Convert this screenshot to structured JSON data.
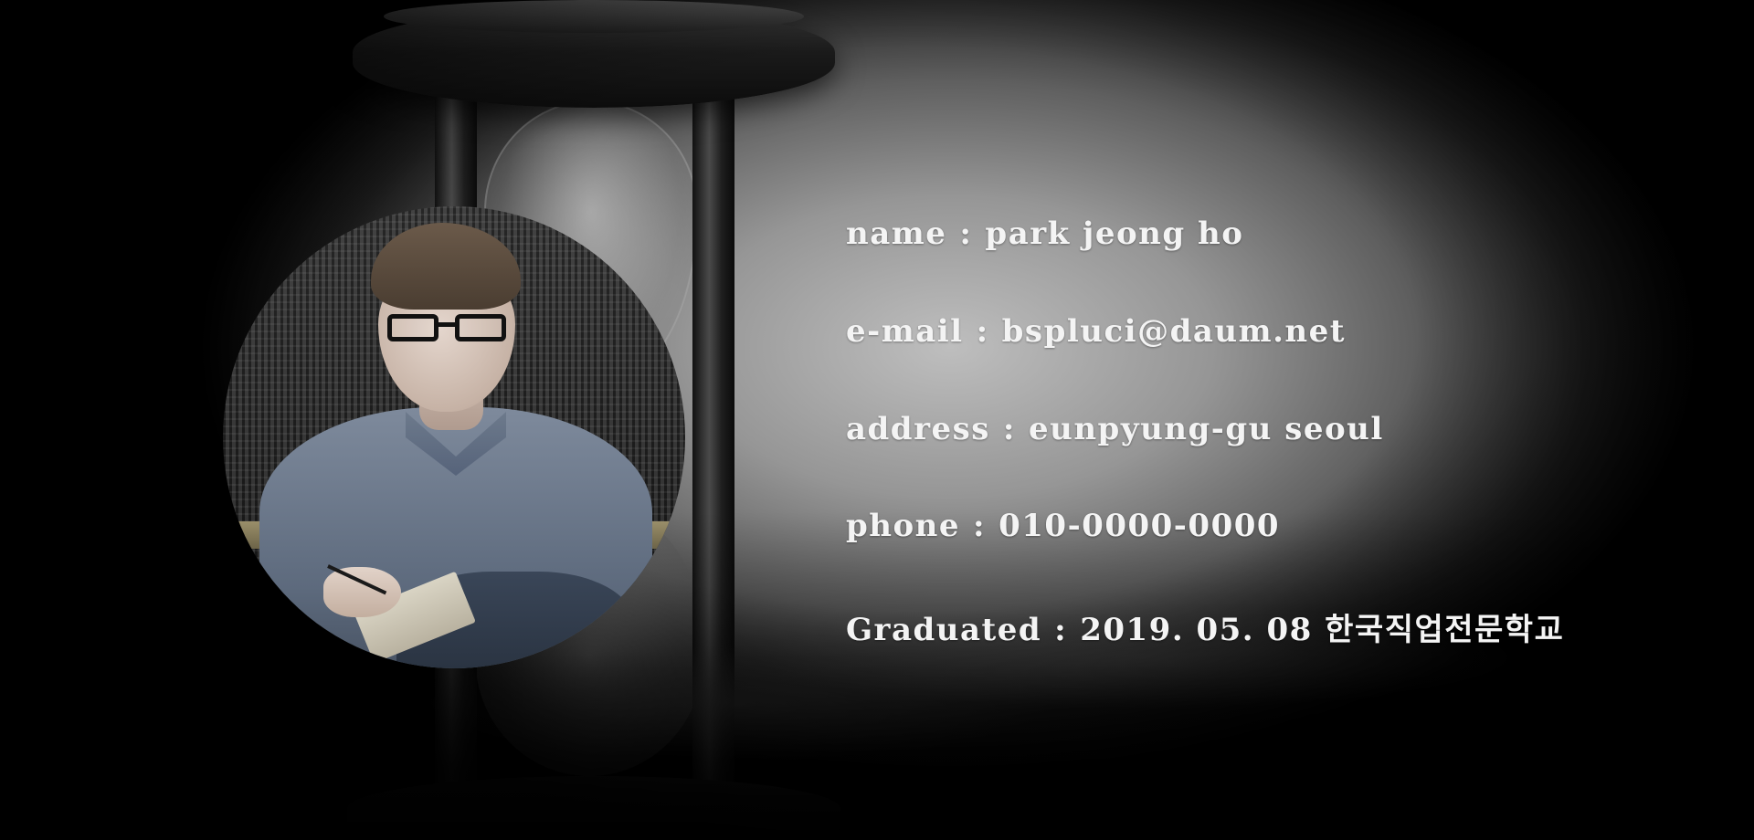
{
  "profile": {
    "separator": ":",
    "name": {
      "label": "name",
      "value": "park jeong ho"
    },
    "email": {
      "label": "e-mail",
      "value": "bspluci@daum.net"
    },
    "address": {
      "label": "address",
      "value": "eunpyung-gu seoul"
    },
    "phone": {
      "label": "phone",
      "value": "010-0000-0000"
    },
    "graduated": {
      "label": "Graduated",
      "value": "2019. 05. 08 한국직업전문학교"
    }
  },
  "images": {
    "background": "hourglass-background",
    "portrait": "profile-portrait"
  }
}
